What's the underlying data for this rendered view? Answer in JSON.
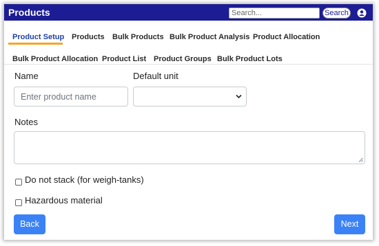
{
  "header": {
    "title": "Products",
    "search_placeholder": "Search...",
    "search_button": "Search",
    "user_icon": "user-icon"
  },
  "tabs": {
    "row1": [
      "Product Setup",
      "Products",
      "Bulk Products",
      "Bulk Product Analysis",
      "Product Allocation"
    ],
    "row2": [
      "Bulk Product Allocation",
      "Product List",
      "Product Groups",
      "Bulk Product Lots"
    ],
    "active": "Product Setup",
    "active_color": "#1f3fa8",
    "active_underline_color": "#f5a623"
  },
  "form": {
    "name_label": "Name",
    "name_placeholder": "Enter product name",
    "name_value": "",
    "unit_label": "Default unit",
    "unit_value": "",
    "notes_label": "Notes",
    "notes_value": "",
    "checkboxes": [
      {
        "label": "Do not stack (for weigh-tanks)",
        "checked": false
      },
      {
        "label": "Hazardous material",
        "checked": false
      }
    ]
  },
  "buttons": {
    "back": "Back",
    "next": "Next",
    "color": "#3b82f6"
  },
  "colors": {
    "header_bg": "#1c1c94"
  }
}
